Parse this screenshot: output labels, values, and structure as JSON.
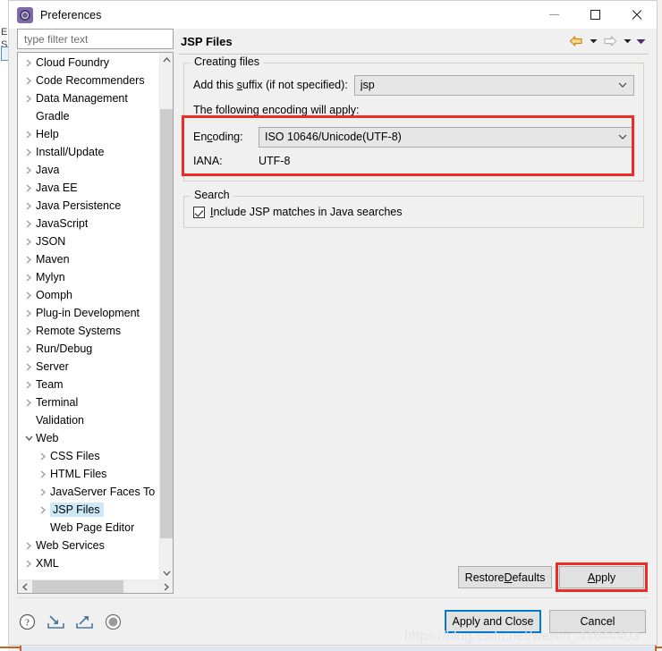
{
  "window": {
    "title": "Preferences",
    "icon": "gear-icon",
    "controls": {
      "minimize": "–",
      "maximize": "□",
      "close": "✕"
    }
  },
  "sidebar": {
    "filter": {
      "value": "",
      "placeholder": "type filter text"
    },
    "items": [
      {
        "label": "Cloud Foundry",
        "expandable": true,
        "expanded": false,
        "depth": 0,
        "selected": false
      },
      {
        "label": "Code Recommenders",
        "expandable": true,
        "expanded": false,
        "depth": 0,
        "selected": false
      },
      {
        "label": "Data Management",
        "expandable": true,
        "expanded": false,
        "depth": 0,
        "selected": false
      },
      {
        "label": "Gradle",
        "expandable": false,
        "expanded": false,
        "depth": 0,
        "selected": false
      },
      {
        "label": "Help",
        "expandable": true,
        "expanded": false,
        "depth": 0,
        "selected": false
      },
      {
        "label": "Install/Update",
        "expandable": true,
        "expanded": false,
        "depth": 0,
        "selected": false
      },
      {
        "label": "Java",
        "expandable": true,
        "expanded": false,
        "depth": 0,
        "selected": false
      },
      {
        "label": "Java EE",
        "expandable": true,
        "expanded": false,
        "depth": 0,
        "selected": false
      },
      {
        "label": "Java Persistence",
        "expandable": true,
        "expanded": false,
        "depth": 0,
        "selected": false
      },
      {
        "label": "JavaScript",
        "expandable": true,
        "expanded": false,
        "depth": 0,
        "selected": false
      },
      {
        "label": "JSON",
        "expandable": true,
        "expanded": false,
        "depth": 0,
        "selected": false
      },
      {
        "label": "Maven",
        "expandable": true,
        "expanded": false,
        "depth": 0,
        "selected": false
      },
      {
        "label": "Mylyn",
        "expandable": true,
        "expanded": false,
        "depth": 0,
        "selected": false
      },
      {
        "label": "Oomph",
        "expandable": true,
        "expanded": false,
        "depth": 0,
        "selected": false
      },
      {
        "label": "Plug-in Development",
        "expandable": true,
        "expanded": false,
        "depth": 0,
        "selected": false
      },
      {
        "label": "Remote Systems",
        "expandable": true,
        "expanded": false,
        "depth": 0,
        "selected": false
      },
      {
        "label": "Run/Debug",
        "expandable": true,
        "expanded": false,
        "depth": 0,
        "selected": false
      },
      {
        "label": "Server",
        "expandable": true,
        "expanded": false,
        "depth": 0,
        "selected": false
      },
      {
        "label": "Team",
        "expandable": true,
        "expanded": false,
        "depth": 0,
        "selected": false
      },
      {
        "label": "Terminal",
        "expandable": true,
        "expanded": false,
        "depth": 0,
        "selected": false
      },
      {
        "label": "Validation",
        "expandable": false,
        "expanded": false,
        "depth": 0,
        "selected": false
      },
      {
        "label": "Web",
        "expandable": true,
        "expanded": true,
        "depth": 0,
        "selected": false
      },
      {
        "label": "CSS Files",
        "expandable": true,
        "expanded": false,
        "depth": 1,
        "selected": false
      },
      {
        "label": "HTML Files",
        "expandable": true,
        "expanded": false,
        "depth": 1,
        "selected": false
      },
      {
        "label": "JavaServer Faces To",
        "expandable": true,
        "expanded": false,
        "depth": 1,
        "selected": false
      },
      {
        "label": "JSP Files",
        "expandable": true,
        "expanded": false,
        "depth": 1,
        "selected": true
      },
      {
        "label": "Web Page Editor",
        "expandable": false,
        "expanded": false,
        "depth": 1,
        "selected": false
      },
      {
        "label": "Web Services",
        "expandable": true,
        "expanded": false,
        "depth": 0,
        "selected": false
      },
      {
        "label": "XML",
        "expandable": true,
        "expanded": false,
        "depth": 0,
        "selected": false
      }
    ]
  },
  "page": {
    "title": "JSP Files",
    "nav": {
      "back_icon": "back-arrow-icon",
      "back_menu_icon": "chevron-down-icon",
      "forward_icon": "forward-arrow-icon",
      "forward_menu_icon": "chevron-down-icon",
      "view_menu_icon": "chevron-down-icon"
    },
    "creating_files": {
      "legend": "Creating files",
      "suffix_label_pre": "Add this ",
      "suffix_label_mnemonic": "s",
      "suffix_label_post": "uffix (if not specified):",
      "suffix_value": "jsp",
      "encoding_note": "The following encoding will apply:",
      "encoding_label_pre": "En",
      "encoding_label_mnemonic": "c",
      "encoding_label_post": "oding:",
      "encoding_value": "ISO 10646/Unicode(UTF-8)",
      "iana_label": "IANA:",
      "iana_value": "UTF-8"
    },
    "search": {
      "legend": "Search",
      "checkbox_label_mnemonic": "I",
      "checkbox_label_post": "nclude JSP matches in Java searches",
      "checked": true
    },
    "restore_defaults_pre": "Restore ",
    "restore_defaults_mnemonic": "D",
    "restore_defaults_post": "efaults",
    "apply_pre": "",
    "apply_mnemonic": "A",
    "apply_post": "pply"
  },
  "footer": {
    "icons": [
      "help-icon",
      "import-icon",
      "export-icon",
      "record-icon"
    ],
    "apply_and_close": "Apply and Close",
    "cancel": "Cancel"
  },
  "watermark": "https://blog.csdn.net/weixin_44644403",
  "background": {
    "letters": [
      "E",
      "S"
    ]
  },
  "colors": {
    "accent_blue": "#0078d7",
    "annotation_red": "#ef2b24",
    "selection_blue": "#cde8f7",
    "back_arrow_gold": "#e8a33d",
    "app_border_orange": "#c4622d"
  }
}
